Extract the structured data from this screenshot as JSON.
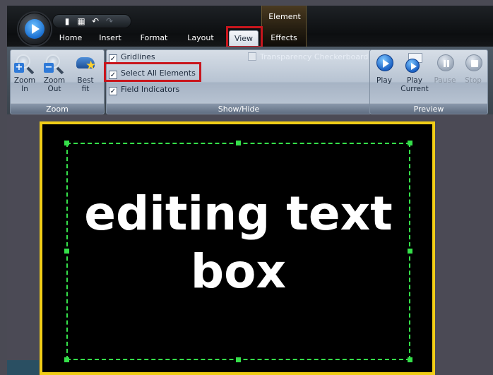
{
  "titlebar": {
    "context_group_label": "Element",
    "tabs": [
      {
        "label": "Home"
      },
      {
        "label": "Insert"
      },
      {
        "label": "Format"
      },
      {
        "label": "Layout"
      },
      {
        "label": "View",
        "selected": true
      },
      {
        "label": "Effects"
      }
    ]
  },
  "ribbon": {
    "zoom": {
      "label": "Zoom",
      "buttons": [
        {
          "label": "Zoom In",
          "icon": "zoom-in-icon"
        },
        {
          "label": "Zoom Out",
          "icon": "zoom-out-icon"
        },
        {
          "label": "Best fit",
          "icon": "best-fit-icon"
        }
      ]
    },
    "show_hide": {
      "label": "Show/Hide",
      "gridlines": {
        "label": "Gridlines",
        "checked": true
      },
      "select_all": {
        "label": "Select All Elements",
        "checked": true
      },
      "field_indicators": {
        "label": "Field Indicators",
        "checked": true
      },
      "transparency": {
        "label": "Transparency Checkerboard",
        "checked": false,
        "enabled": false
      }
    },
    "preview": {
      "label": "Preview",
      "buttons": [
        {
          "label": "Play",
          "enabled": true
        },
        {
          "label": "Play Current",
          "enabled": true
        },
        {
          "label": "Pause",
          "enabled": false
        },
        {
          "label": "Stop",
          "enabled": false
        }
      ]
    }
  },
  "canvas": {
    "text_line1": "editing text",
    "text_line2": "box",
    "border_color": "#f0cd17",
    "selection_color": "#35e04a",
    "highlight_color": "#c8161d"
  }
}
